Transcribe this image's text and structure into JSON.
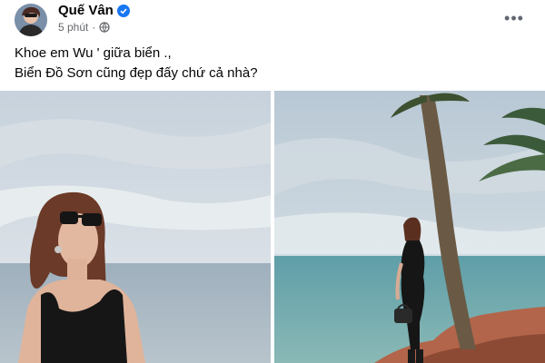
{
  "post": {
    "author": "Quế Vân",
    "time": "5 phút",
    "separator": "·",
    "more_label": "•••",
    "caption_lines": [
      "Khoe em Wu ' giữa biển .,",
      "Biển Đồ Sơn cũng đẹp đấy chứ cả nhà?"
    ]
  },
  "icons": {
    "verified": "verified-badge-icon",
    "privacy": "globe-icon",
    "more": "more-horizontal-icon"
  },
  "colors": {
    "verified_badge": "#1877f2",
    "text_primary": "#050505",
    "text_secondary": "#65676b"
  }
}
